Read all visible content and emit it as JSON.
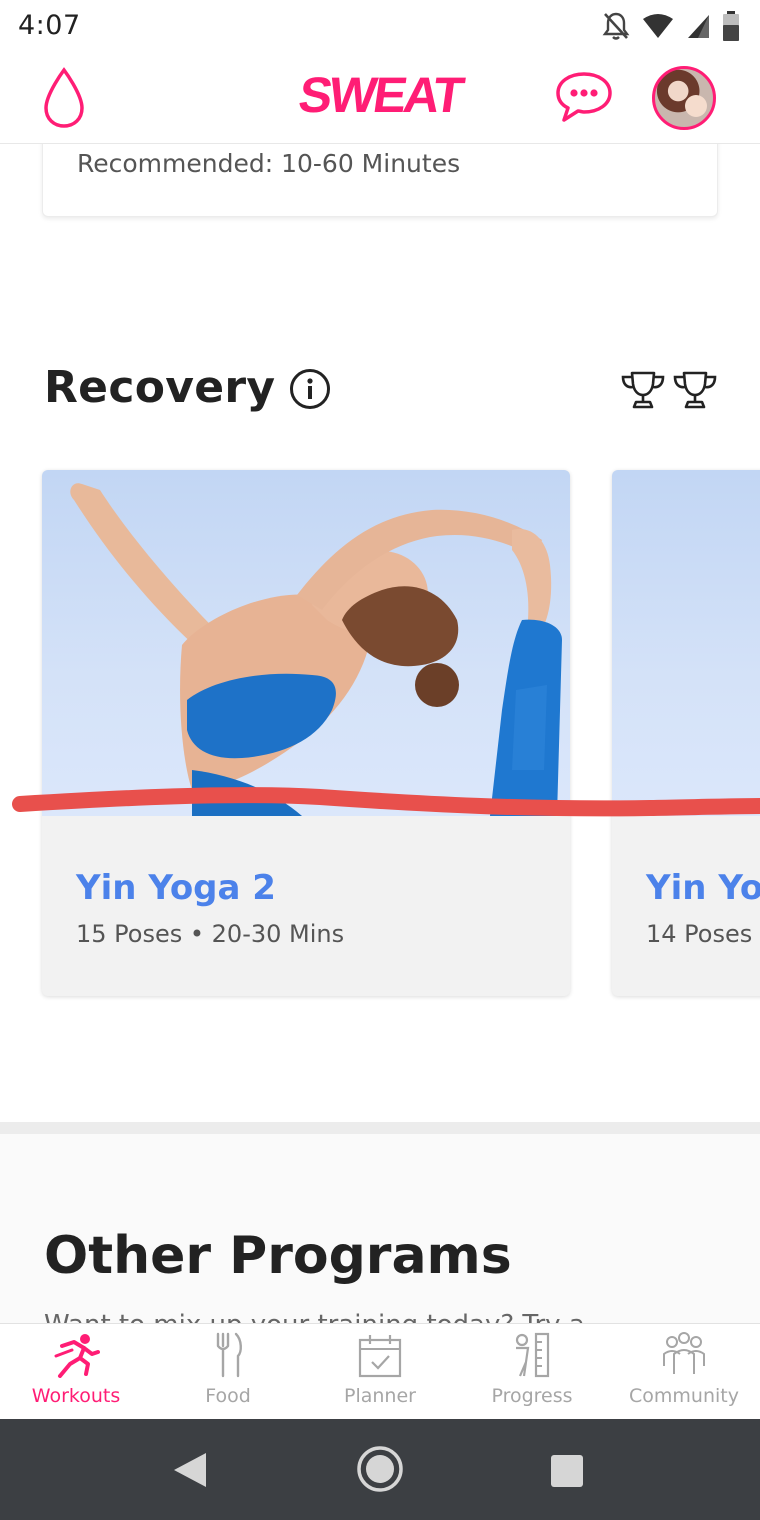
{
  "status_bar": {
    "time": "4:07",
    "icons": [
      "notifications-off-icon",
      "wifi-icon",
      "signal-icon",
      "battery-icon"
    ]
  },
  "header": {
    "brand": "SWEAT",
    "brand_color": "#ff1d75",
    "left_icon": "water-drop-icon",
    "chat_icon": "chat-bubble-icon",
    "avatar": "profile-avatar"
  },
  "top_card": {
    "recommended": "Recommended: 10-60 Minutes"
  },
  "recovery": {
    "title": "Recovery",
    "info_icon": "info-icon",
    "trophy_icon": "trophy-icon",
    "cards": [
      {
        "title": "Yin Yoga 2",
        "meta": "15 Poses • 20-30 Mins"
      },
      {
        "title": "Yin Yo",
        "meta": "14 Poses"
      }
    ]
  },
  "other_programs": {
    "title": "Other Programs",
    "description": "Want to mix up your training today? Try a"
  },
  "bottom_nav": {
    "items": [
      {
        "label": "Workouts",
        "icon": "running-person-icon",
        "active": true
      },
      {
        "label": "Food",
        "icon": "fork-knife-icon",
        "active": false
      },
      {
        "label": "Planner",
        "icon": "calendar-icon",
        "active": false
      },
      {
        "label": "Progress",
        "icon": "measure-icon",
        "active": false
      },
      {
        "label": "Community",
        "icon": "people-icon",
        "active": false
      }
    ]
  },
  "colors": {
    "accent": "#ff1d75",
    "link_blue": "#4c82ea",
    "annotation_red": "#e8504c",
    "android_bar": "#3c3f43"
  }
}
